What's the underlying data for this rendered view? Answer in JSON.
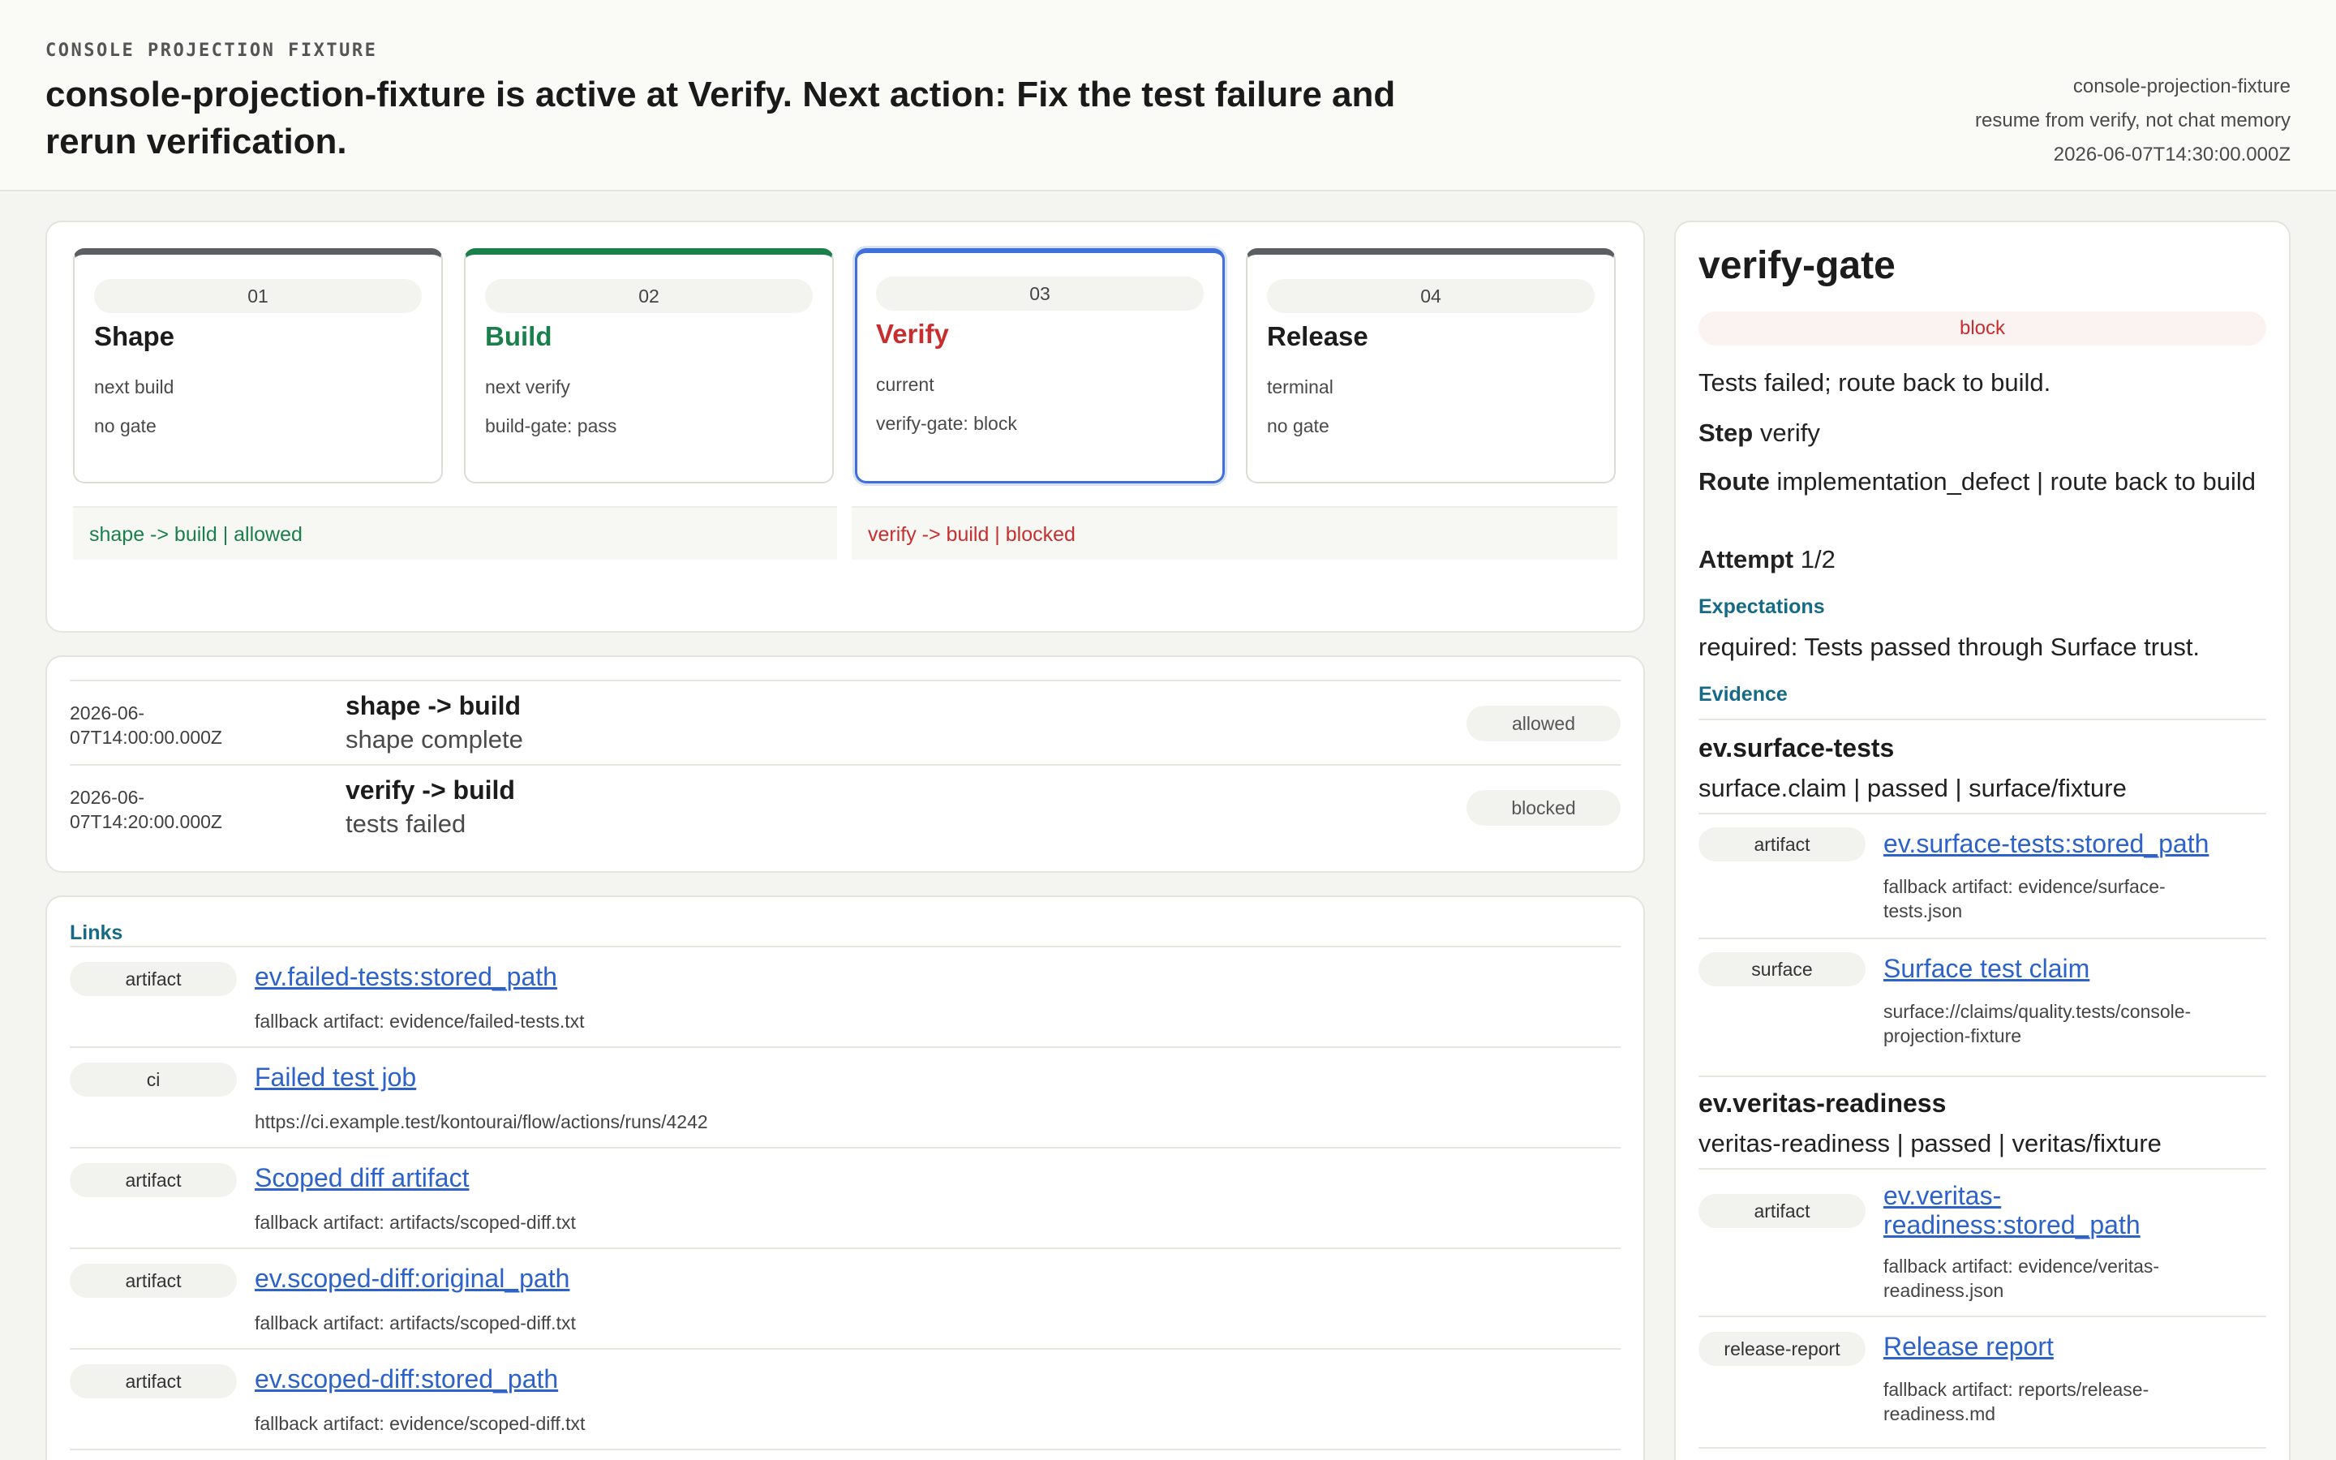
{
  "header": {
    "eyebrow": "CONSOLE PROJECTION FIXTURE",
    "headline": "console-projection-fixture is active at Verify. Next action: Fix the test failure and rerun verification.",
    "meta": [
      "console-projection-fixture",
      "resume from verify, not chat memory",
      "2026-06-07T14:30:00.000Z"
    ]
  },
  "stages": [
    {
      "num": "01",
      "name": "Shape",
      "line1": "next build",
      "line2": "no gate"
    },
    {
      "num": "02",
      "name": "Build",
      "line1": "next verify",
      "line2": "build-gate: pass"
    },
    {
      "num": "03",
      "name": "Verify",
      "line1": "current",
      "line2": "verify-gate: block"
    },
    {
      "num": "04",
      "name": "Release",
      "line1": "terminal",
      "line2": "no gate"
    }
  ],
  "transitions": [
    "shape -> build | allowed",
    "verify -> build | blocked"
  ],
  "history": [
    {
      "time_date": "2026-06-",
      "time_rest": "07T14:00:00.000Z",
      "title": "shape -> build",
      "sub": "shape complete",
      "status": "allowed"
    },
    {
      "time_date": "2026-06-",
      "time_rest": "07T14:20:00.000Z",
      "title": "verify -> build",
      "sub": "tests failed",
      "status": "blocked"
    }
  ],
  "links": {
    "label": "Links",
    "items": [
      {
        "kind": "artifact",
        "title": "ev.failed-tests:stored_path",
        "sub": "fallback artifact: evidence/failed-tests.txt"
      },
      {
        "kind": "ci",
        "title": "Failed test job",
        "sub": "https://ci.example.test/kontourai/flow/actions/runs/4242"
      },
      {
        "kind": "artifact",
        "title": "Scoped diff artifact",
        "sub": "fallback artifact: artifacts/scoped-diff.txt"
      },
      {
        "kind": "artifact",
        "title": "ev.scoped-diff:original_path",
        "sub": "fallback artifact: artifacts/scoped-diff.txt"
      },
      {
        "kind": "artifact",
        "title": "ev.scoped-diff:stored_path",
        "sub": "fallback artifact: evidence/scoped-diff.txt"
      }
    ]
  },
  "gate": {
    "title": "verify-gate",
    "status": "block",
    "summary": "Tests failed; route back to build.",
    "step_label": "Step",
    "step_value": "verify",
    "route_label": "Route",
    "route_value": "implementation_defect | route back to build",
    "attempt_label": "Attempt",
    "attempt_value": "1/2",
    "expectations_label": "Expectations",
    "expectation": "required: Tests passed through Surface trust.",
    "evidence_label": "Evidence",
    "evidence": [
      {
        "name": "ev.surface-tests",
        "summary": "surface.claim | passed | surface/fixture",
        "links": [
          {
            "kind": "artifact",
            "title": "ev.surface-tests:stored_path",
            "sub1": "fallback artifact: evidence/surface-",
            "sub2": "tests.json"
          },
          {
            "kind": "surface",
            "title": "Surface test claim",
            "sub1": "surface://claims/quality.tests/console-",
            "sub2": "projection-fixture"
          }
        ]
      },
      {
        "name": "ev.veritas-readiness",
        "summary": "veritas-readiness | passed | veritas/fixture",
        "links": [
          {
            "kind": "artifact",
            "title1": "ev.veritas-",
            "title2": "readiness:stored_path",
            "sub1": "fallback artifact: evidence/veritas-",
            "sub2": "readiness.json"
          },
          {
            "kind": "release-report",
            "title": "Release report",
            "sub1": "fallback artifact: reports/release-",
            "sub2": "readiness.md"
          }
        ]
      }
    ]
  }
}
